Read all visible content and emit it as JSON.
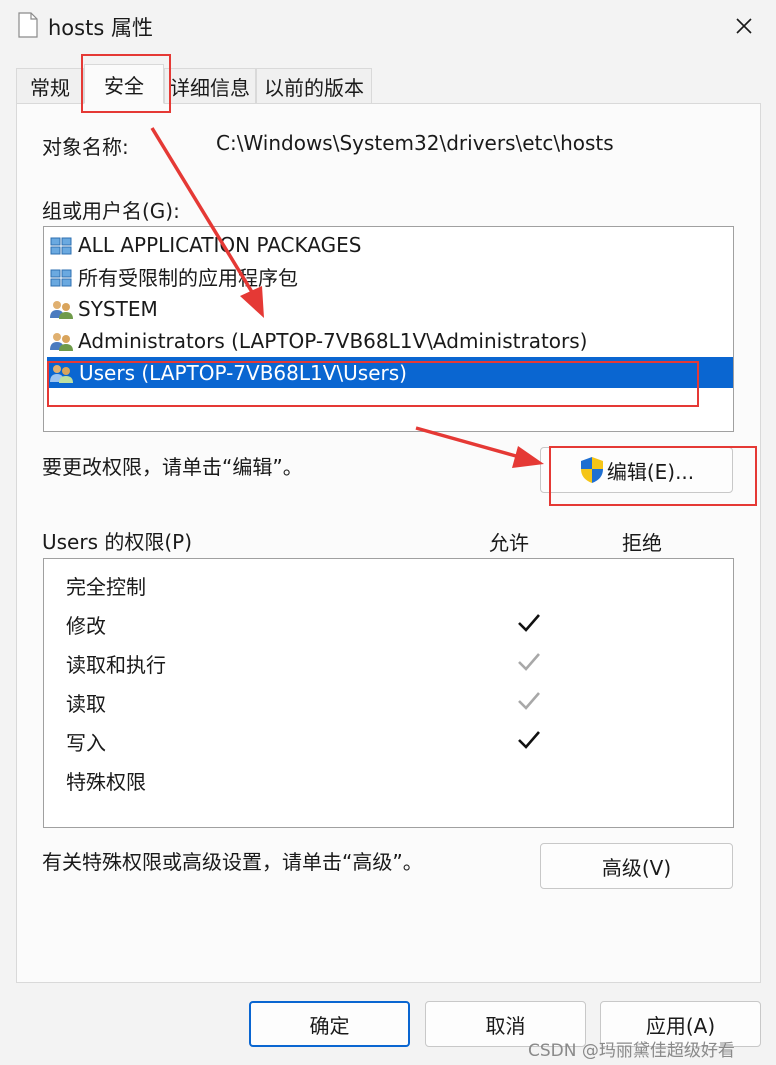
{
  "window": {
    "title": "hosts 属性",
    "close_icon": "close-icon"
  },
  "tabs": [
    {
      "label": "常规",
      "active": false
    },
    {
      "label": "安全",
      "active": true
    },
    {
      "label": "详细信息",
      "active": false
    },
    {
      "label": "以前的版本",
      "active": false
    }
  ],
  "security": {
    "object_name_label": "对象名称:",
    "object_name_value": "C:\\Windows\\System32\\drivers\\etc\\hosts",
    "groups_label": "组或用户名(G):",
    "groups": [
      {
        "name": "ALL APPLICATION PACKAGES",
        "icon": "package-group-icon",
        "selected": false
      },
      {
        "name": "所有受限制的应用程序包",
        "icon": "package-group-icon",
        "selected": false
      },
      {
        "name": "SYSTEM",
        "icon": "users-group-icon",
        "selected": false
      },
      {
        "name": "Administrators (LAPTOP-7VB68L1V\\Administrators)",
        "icon": "users-group-icon",
        "selected": false
      },
      {
        "name": "Users (LAPTOP-7VB68L1V\\Users)",
        "icon": "users-group-icon",
        "selected": true
      }
    ],
    "edit_hint": "要更改权限，请单击“编辑”。",
    "edit_button": "编辑(E)...",
    "edit_button_icon": "uac-shield-icon",
    "permissions_label": "Users 的权限(P)",
    "allow_header": "允许",
    "deny_header": "拒绝",
    "permissions": [
      {
        "name": "完全控制",
        "allow": "none",
        "deny": "none"
      },
      {
        "name": "修改",
        "allow": "checked",
        "deny": "none"
      },
      {
        "name": "读取和执行",
        "allow": "inherited",
        "deny": "none"
      },
      {
        "name": "读取",
        "allow": "inherited",
        "deny": "none"
      },
      {
        "name": "写入",
        "allow": "checked",
        "deny": "none"
      },
      {
        "name": "特殊权限",
        "allow": "none",
        "deny": "none"
      }
    ],
    "advanced_hint": "有关特殊权限或高级设置，请单击“高级”。",
    "advanced_button": "高级(V)"
  },
  "footer": {
    "ok_button": "确定",
    "cancel_button": "取消",
    "apply_button": "应用(A)"
  },
  "watermark": "CSDN @玛丽黛佳超级好看",
  "colors": {
    "selection": "#0a66d1",
    "annotation_red": "#e53935",
    "check_active": "#111111",
    "check_inherited": "#a8a8a8"
  }
}
